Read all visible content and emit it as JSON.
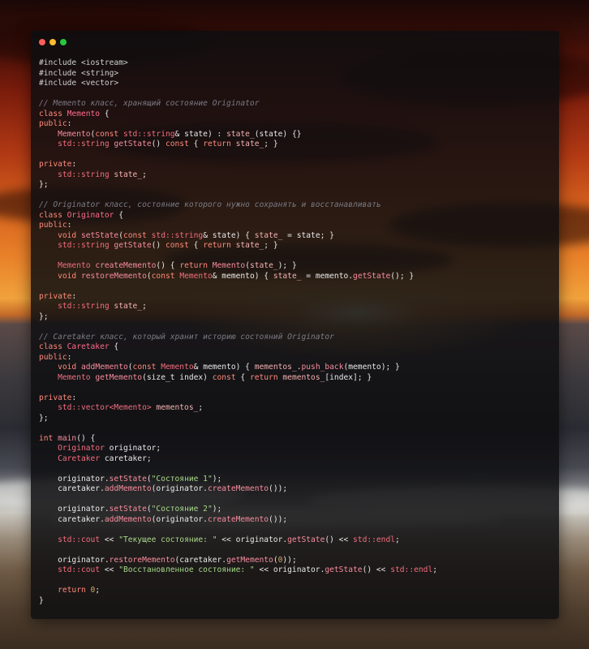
{
  "window": {
    "controls": [
      "close",
      "minimize",
      "maximize"
    ]
  },
  "code": {
    "lines": [
      [
        [
          "pre",
          "#include <iostream>"
        ]
      ],
      [
        [
          "pre",
          "#include <string>"
        ]
      ],
      [
        [
          "pre",
          "#include <vector>"
        ]
      ],
      [],
      [
        [
          "comment",
          "// Memento класс, хранящий состояние Originator"
        ]
      ],
      [
        [
          "kw",
          "class "
        ],
        [
          "class",
          "Memento"
        ],
        [
          "plain",
          " {"
        ]
      ],
      [
        [
          "kw",
          "public"
        ],
        [
          "plain",
          ":"
        ]
      ],
      [
        [
          "plain",
          "    "
        ],
        [
          "fn",
          "Memento"
        ],
        [
          "plain",
          "("
        ],
        [
          "kw",
          "const "
        ],
        [
          "type",
          "std::string"
        ],
        [
          "plain",
          "& state) : "
        ],
        [
          "id",
          "state_"
        ],
        [
          "plain",
          "(state) {}"
        ]
      ],
      [
        [
          "plain",
          "    "
        ],
        [
          "type",
          "std::string "
        ],
        [
          "fn",
          "getState"
        ],
        [
          "plain",
          "() "
        ],
        [
          "kw",
          "const"
        ],
        [
          "plain",
          " { "
        ],
        [
          "kw",
          "return "
        ],
        [
          "id",
          "state_"
        ],
        [
          "plain",
          "; }"
        ]
      ],
      [],
      [
        [
          "kw",
          "private"
        ],
        [
          "plain",
          ":"
        ]
      ],
      [
        [
          "plain",
          "    "
        ],
        [
          "type",
          "std::string "
        ],
        [
          "id",
          "state_"
        ],
        [
          "plain",
          ";"
        ]
      ],
      [
        [
          "plain",
          "};"
        ]
      ],
      [],
      [
        [
          "comment",
          "// Originator класс, состояние которого нужно сохранять и восстанавливать"
        ]
      ],
      [
        [
          "kw",
          "class "
        ],
        [
          "class",
          "Originator"
        ],
        [
          "plain",
          " {"
        ]
      ],
      [
        [
          "kw",
          "public"
        ],
        [
          "plain",
          ":"
        ]
      ],
      [
        [
          "plain",
          "    "
        ],
        [
          "kw",
          "void "
        ],
        [
          "fn",
          "setState"
        ],
        [
          "plain",
          "("
        ],
        [
          "kw",
          "const "
        ],
        [
          "type",
          "std::string"
        ],
        [
          "plain",
          "& state) { "
        ],
        [
          "id",
          "state_"
        ],
        [
          "plain",
          " = state; }"
        ]
      ],
      [
        [
          "plain",
          "    "
        ],
        [
          "type",
          "std::string "
        ],
        [
          "fn",
          "getState"
        ],
        [
          "plain",
          "() "
        ],
        [
          "kw",
          "const"
        ],
        [
          "plain",
          " { "
        ],
        [
          "kw",
          "return "
        ],
        [
          "id",
          "state_"
        ],
        [
          "plain",
          "; }"
        ]
      ],
      [],
      [
        [
          "plain",
          "    "
        ],
        [
          "type",
          "Memento "
        ],
        [
          "fn",
          "createMemento"
        ],
        [
          "plain",
          "() { "
        ],
        [
          "kw",
          "return "
        ],
        [
          "fn",
          "Memento"
        ],
        [
          "plain",
          "("
        ],
        [
          "id",
          "state_"
        ],
        [
          "plain",
          "); }"
        ]
      ],
      [
        [
          "plain",
          "    "
        ],
        [
          "kw",
          "void "
        ],
        [
          "fn",
          "restoreMemento"
        ],
        [
          "plain",
          "("
        ],
        [
          "kw",
          "const "
        ],
        [
          "type",
          "Memento"
        ],
        [
          "plain",
          "& memento) { "
        ],
        [
          "id",
          "state_"
        ],
        [
          "plain",
          " = memento."
        ],
        [
          "fn",
          "getState"
        ],
        [
          "plain",
          "(); }"
        ]
      ],
      [],
      [
        [
          "kw",
          "private"
        ],
        [
          "plain",
          ":"
        ]
      ],
      [
        [
          "plain",
          "    "
        ],
        [
          "type",
          "std::string "
        ],
        [
          "id",
          "state_"
        ],
        [
          "plain",
          ";"
        ]
      ],
      [
        [
          "plain",
          "};"
        ]
      ],
      [],
      [
        [
          "comment",
          "// Caretaker класс, который хранит историю состояний Originator"
        ]
      ],
      [
        [
          "kw",
          "class "
        ],
        [
          "class",
          "Caretaker"
        ],
        [
          "plain",
          " {"
        ]
      ],
      [
        [
          "kw",
          "public"
        ],
        [
          "plain",
          ":"
        ]
      ],
      [
        [
          "plain",
          "    "
        ],
        [
          "kw",
          "void "
        ],
        [
          "fn",
          "addMemento"
        ],
        [
          "plain",
          "("
        ],
        [
          "kw",
          "const "
        ],
        [
          "type",
          "Memento"
        ],
        [
          "plain",
          "& memento) { "
        ],
        [
          "id",
          "mementos_"
        ],
        [
          "plain",
          "."
        ],
        [
          "fn",
          "push_back"
        ],
        [
          "plain",
          "(memento); }"
        ]
      ],
      [
        [
          "plain",
          "    "
        ],
        [
          "type",
          "Memento "
        ],
        [
          "fn",
          "getMemento"
        ],
        [
          "plain",
          "(size_t index) "
        ],
        [
          "kw",
          "const"
        ],
        [
          "plain",
          " { "
        ],
        [
          "kw",
          "return "
        ],
        [
          "id",
          "mementos_"
        ],
        [
          "plain",
          "[index]; }"
        ]
      ],
      [],
      [
        [
          "kw",
          "private"
        ],
        [
          "plain",
          ":"
        ]
      ],
      [
        [
          "plain",
          "    "
        ],
        [
          "type",
          "std::vector<Memento> "
        ],
        [
          "id",
          "mementos_"
        ],
        [
          "plain",
          ";"
        ]
      ],
      [
        [
          "plain",
          "};"
        ]
      ],
      [],
      [
        [
          "kw",
          "int "
        ],
        [
          "fn",
          "main"
        ],
        [
          "plain",
          "() {"
        ]
      ],
      [
        [
          "plain",
          "    "
        ],
        [
          "type",
          "Originator "
        ],
        [
          "plain",
          "originator;"
        ]
      ],
      [
        [
          "plain",
          "    "
        ],
        [
          "type",
          "Caretaker "
        ],
        [
          "plain",
          "caretaker;"
        ]
      ],
      [],
      [
        [
          "plain",
          "    originator."
        ],
        [
          "fn",
          "setState"
        ],
        [
          "plain",
          "("
        ],
        [
          "str",
          "\"Состояние 1\""
        ],
        [
          "plain",
          ");"
        ]
      ],
      [
        [
          "plain",
          "    caretaker."
        ],
        [
          "fn",
          "addMemento"
        ],
        [
          "plain",
          "(originator."
        ],
        [
          "fn",
          "createMemento"
        ],
        [
          "plain",
          "());"
        ]
      ],
      [],
      [
        [
          "plain",
          "    originator."
        ],
        [
          "fn",
          "setState"
        ],
        [
          "plain",
          "("
        ],
        [
          "str",
          "\"Состояние 2\""
        ],
        [
          "plain",
          ");"
        ]
      ],
      [
        [
          "plain",
          "    caretaker."
        ],
        [
          "fn",
          "addMemento"
        ],
        [
          "plain",
          "(originator."
        ],
        [
          "fn",
          "createMemento"
        ],
        [
          "plain",
          "());"
        ]
      ],
      [],
      [
        [
          "plain",
          "    "
        ],
        [
          "type",
          "std::cout"
        ],
        [
          "plain",
          " << "
        ],
        [
          "str",
          "\"Текущее состояние: \""
        ],
        [
          "plain",
          " << originator."
        ],
        [
          "fn",
          "getState"
        ],
        [
          "plain",
          "() << "
        ],
        [
          "type",
          "std::endl"
        ],
        [
          "plain",
          ";"
        ]
      ],
      [],
      [
        [
          "plain",
          "    originator."
        ],
        [
          "fn",
          "restoreMemento"
        ],
        [
          "plain",
          "(caretaker."
        ],
        [
          "fn",
          "getMemento"
        ],
        [
          "plain",
          "("
        ],
        [
          "num",
          "0"
        ],
        [
          "plain",
          "));"
        ]
      ],
      [
        [
          "plain",
          "    "
        ],
        [
          "type",
          "std::cout"
        ],
        [
          "plain",
          " << "
        ],
        [
          "str",
          "\"Восстановленное состояние: \""
        ],
        [
          "plain",
          " << originator."
        ],
        [
          "fn",
          "getState"
        ],
        [
          "plain",
          "() << "
        ],
        [
          "type",
          "std::endl"
        ],
        [
          "plain",
          ";"
        ]
      ],
      [],
      [
        [
          "plain",
          "    "
        ],
        [
          "kw",
          "return "
        ],
        [
          "num",
          "0"
        ],
        [
          "plain",
          ";"
        ]
      ],
      [
        [
          "plain",
          "}"
        ]
      ]
    ]
  }
}
